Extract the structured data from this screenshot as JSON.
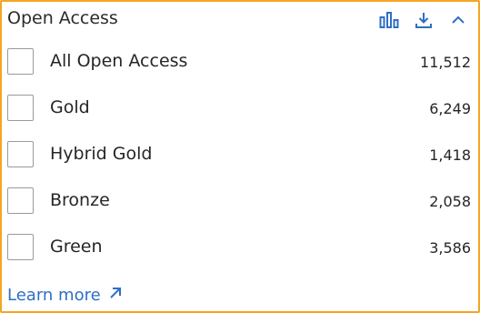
{
  "header": {
    "title": "Open Access"
  },
  "icons": {
    "chart": "bar-chart-icon",
    "download": "download-icon",
    "collapse": "chevron-up-icon",
    "learn_more": "arrow-up-right-icon"
  },
  "items": [
    {
      "label": "All Open Access",
      "count": "11,512",
      "checked": false
    },
    {
      "label": "Gold",
      "count": "6,249",
      "checked": false
    },
    {
      "label": "Hybrid Gold",
      "count": "1,418",
      "checked": false
    },
    {
      "label": "Bronze",
      "count": "2,058",
      "checked": false
    },
    {
      "label": "Green",
      "count": "3,586",
      "checked": false
    }
  ],
  "footer": {
    "learn_more_label": "Learn more"
  },
  "colors": {
    "border": "#f5a623",
    "accent": "#2e6fc4"
  }
}
